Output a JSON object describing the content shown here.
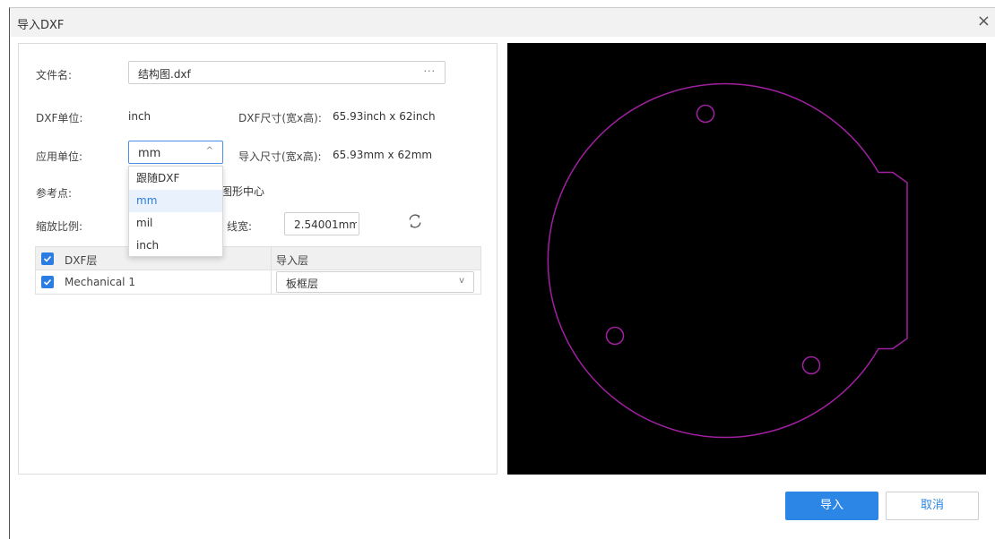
{
  "dialog": {
    "title": "导入DXF",
    "close_glyph": "×"
  },
  "form": {
    "filename_label": "文件名:",
    "filename_value": "结构图.dxf",
    "filename_browse": "···",
    "dxf_unit_label": "DXF单位:",
    "dxf_unit_value": "inch",
    "dxf_size_label": "DXF尺寸(宽x高):",
    "dxf_size_value": "65.93inch x 62inch",
    "app_unit_label": "应用单位:",
    "app_unit_value": "mm",
    "import_size_label": "导入尺寸(宽x高):",
    "import_size_value": "65.93mm x 62mm",
    "ref_point_label": "参考点:",
    "ref_point_value": "图形中心",
    "scale_label": "缩放比例:",
    "linewidth_label": "线宽:",
    "linewidth_value": "2.54001mm"
  },
  "unit_options": [
    "跟随DXF",
    "mm",
    "mil",
    "inch"
  ],
  "unit_selected_index": 1,
  "table": {
    "col_dxf_layer": "DXF层",
    "col_import_layer": "导入层",
    "rows": [
      {
        "dxf_layer": "Mechanical 1",
        "import_layer": "板框层",
        "checked": true
      }
    ],
    "header_checked": true
  },
  "buttons": {
    "import": "导入",
    "cancel": "取消"
  },
  "colors": {
    "accent": "#2b86e6",
    "outline": "#a020a0",
    "preview_bg": "#000000"
  }
}
